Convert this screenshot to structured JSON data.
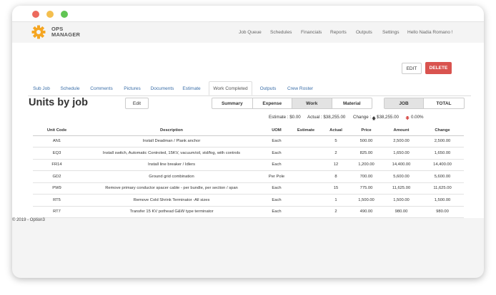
{
  "app": {
    "logo_line1": "OPS",
    "logo_line2": "MANAGER",
    "logo_colors": {
      "primary": "#f5a623"
    }
  },
  "nav": {
    "items": [
      "Job Queue",
      "Schedules",
      "Financials",
      "Reports",
      "Outputs",
      "Settings"
    ],
    "greeting": "Hello Nadia Romano !"
  },
  "actions": {
    "edit_label": "EDIT",
    "delete_label": "DELETE"
  },
  "tabs": [
    {
      "label": "Sub Job"
    },
    {
      "label": "Schedule"
    },
    {
      "label": "Comments"
    },
    {
      "label": "Pictures"
    },
    {
      "label": "Documents"
    },
    {
      "label": "Estimate"
    },
    {
      "label": "Work Completed",
      "active": true
    },
    {
      "label": "Outputs"
    },
    {
      "label": "Crew Roster"
    }
  ],
  "page": {
    "title": "Units by job",
    "edit_label": "Edit"
  },
  "type_filter": {
    "options": [
      "Summary",
      "Expense",
      "Work",
      "Material"
    ],
    "selected": "Work"
  },
  "scope_filter": {
    "options": [
      "JOB",
      "TOTAL"
    ],
    "selected": "JOB"
  },
  "summary": {
    "estimate": "Estimate : $0.00",
    "actual": "Actual : $38,255.00",
    "change_label": "Change :",
    "change_value": "$38,255.00",
    "change_pct": "0.00%",
    "up_icon": "arrow-up-icon",
    "down_icon": "arrow-down-icon"
  },
  "table": {
    "columns": [
      "Unit Code",
      "Description",
      "UOM",
      "Estimate",
      "Actual",
      "Price",
      "Amount",
      "Change"
    ],
    "rows": [
      [
        "AN1",
        "Install Deadman / Plank anchor",
        "Each",
        "",
        "5",
        "500.00",
        "2,500.00",
        "2,500.00"
      ],
      [
        "EQ3",
        "Install switch, Automatic Controled, 15KV, vacuum/oil, std/fog, with controls",
        "Each",
        "",
        "2",
        "825.00",
        "1,650.00",
        "1,650.00"
      ],
      [
        "FR14",
        "Install line breaker / Idlers",
        "Each",
        "",
        "12",
        "1,200.00",
        "14,400.00",
        "14,400.00"
      ],
      [
        "GD2",
        "Ground grid combination",
        "Per Pole",
        "",
        "8",
        "700.00",
        "5,600.00",
        "5,600.00"
      ],
      [
        "PW9",
        "Remove primary conductor spacer cable - per bundle, per section / span",
        "Each",
        "",
        "15",
        "775.00",
        "11,625.00",
        "11,625.00"
      ],
      [
        "RT5",
        "Remove Cold Shrink Terminator -All sizes",
        "Each",
        "",
        "1",
        "1,500.00",
        "1,500.00",
        "1,500.00"
      ],
      [
        "RT7",
        "Transfer 15 KV pothead G&W type terminator",
        "Each",
        "",
        "2",
        "490.00",
        "980.00",
        "980.00"
      ]
    ]
  },
  "footer": {
    "text": "© 2019 - Option3"
  }
}
